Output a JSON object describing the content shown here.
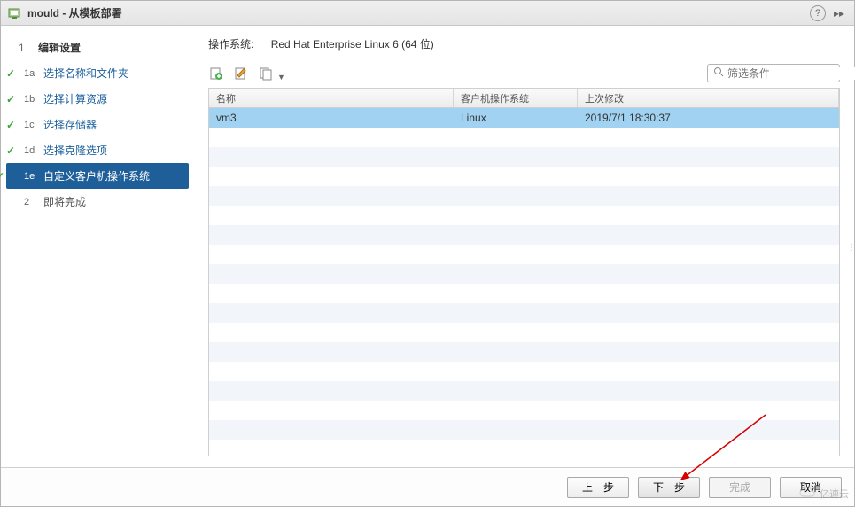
{
  "window": {
    "title": "mould - 从模板部署"
  },
  "sidebar": {
    "header": {
      "num": "1",
      "label": "编辑设置"
    },
    "steps": [
      {
        "num": "1a",
        "label": "选择名称和文件夹",
        "state": "completed"
      },
      {
        "num": "1b",
        "label": "选择计算资源",
        "state": "completed"
      },
      {
        "num": "1c",
        "label": "选择存储器",
        "state": "completed"
      },
      {
        "num": "1d",
        "label": "选择克隆选项",
        "state": "completed"
      },
      {
        "num": "1e",
        "label": "自定义客户机操作系统",
        "state": "active"
      }
    ],
    "final": {
      "num": "2",
      "label": "即将完成",
      "state": "pending"
    }
  },
  "content": {
    "os_label": "操作系统:",
    "os_value": "Red Hat Enterprise Linux 6 (64 位)",
    "filter_placeholder": "筛选条件",
    "columns": {
      "name": "名称",
      "guest_os": "客户机操作系统",
      "modified": "上次修改"
    },
    "rows": [
      {
        "name": "vm3",
        "guest_os": "Linux",
        "modified": "2019/7/1 18:30:37",
        "selected": true
      }
    ]
  },
  "buttons": {
    "back": "上一步",
    "next": "下一步",
    "finish": "完成",
    "cancel": "取消"
  },
  "watermark": "亿速云"
}
